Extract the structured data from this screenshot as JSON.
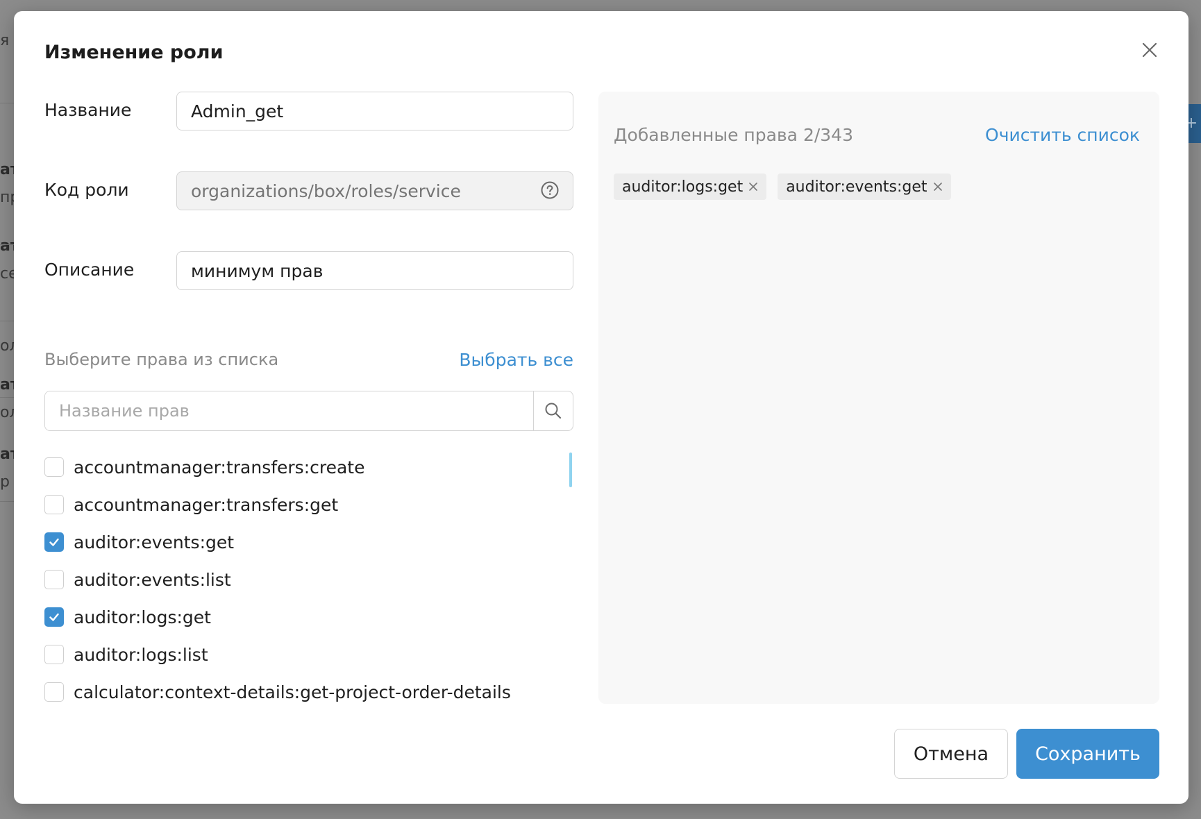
{
  "background": {
    "fragments": [
      {
        "text": "я",
        "bold": false
      },
      {
        "text": "ат",
        "bold": true
      },
      {
        "text": "пр",
        "bold": false
      },
      {
        "text": "ат",
        "bold": true
      },
      {
        "text": "се",
        "bold": false
      },
      {
        "text": "ол",
        "bold": false
      },
      {
        "text": "ат",
        "bold": true
      },
      {
        "text": "ол",
        "bold": false
      },
      {
        "text": "ат",
        "bold": true
      },
      {
        "text": "р",
        "bold": false
      }
    ],
    "right_button_label": "+"
  },
  "modal": {
    "title": "Изменение роли",
    "close_icon": "close-icon"
  },
  "form": {
    "name": {
      "label": "Название",
      "value": "Admin_get"
    },
    "role_code": {
      "label": "Код роли",
      "placeholder": "organizations/box/roles/service",
      "help_icon": "help-circle-icon"
    },
    "description": {
      "label": "Описание",
      "value": "минимум прав"
    }
  },
  "permissions": {
    "section_label": "Выберите права из списка",
    "select_all_label": "Выбрать все",
    "search_placeholder": "Название прав",
    "search_icon": "search-icon",
    "items": [
      {
        "label": "accountmanager:transfers:create",
        "checked": false
      },
      {
        "label": "accountmanager:transfers:get",
        "checked": false
      },
      {
        "label": "auditor:events:get",
        "checked": true
      },
      {
        "label": "auditor:events:list",
        "checked": false
      },
      {
        "label": "auditor:logs:get",
        "checked": true
      },
      {
        "label": "auditor:logs:list",
        "checked": false
      },
      {
        "label": "calculator:context-details:get-project-order-details",
        "checked": false
      }
    ]
  },
  "added": {
    "title": "Добавленные права 2/343",
    "clear_label": "Очистить список",
    "tags": [
      {
        "label": "auditor:logs:get"
      },
      {
        "label": "auditor:events:get"
      }
    ]
  },
  "footer": {
    "cancel_label": "Отмена",
    "save_label": "Сохранить"
  },
  "colors": {
    "accent": "#3d8fd1",
    "overlay": "#8a8a8a",
    "panel": "#f8f8f8",
    "tag": "#ececec"
  }
}
